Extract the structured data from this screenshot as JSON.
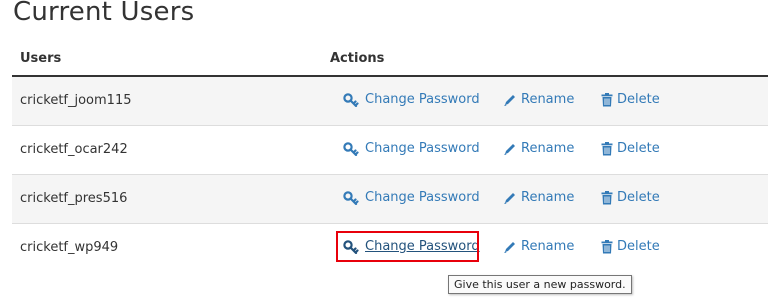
{
  "page": {
    "title": "Current Users"
  },
  "table": {
    "headers": {
      "users": "Users",
      "actions": "Actions"
    },
    "rows": [
      {
        "user": "cricketf_joom115"
      },
      {
        "user": "cricketf_ocar242"
      },
      {
        "user": "cricketf_pres516"
      },
      {
        "user": "cricketf_wp949"
      }
    ],
    "actions": {
      "change_password": "Change Password",
      "rename": "Rename",
      "delete": "Delete"
    }
  },
  "tooltip": {
    "text": "Give this user a new password."
  },
  "colors": {
    "link": "#337ab7",
    "highlight": "#e8000b",
    "row_alt": "#f5f5f5"
  }
}
